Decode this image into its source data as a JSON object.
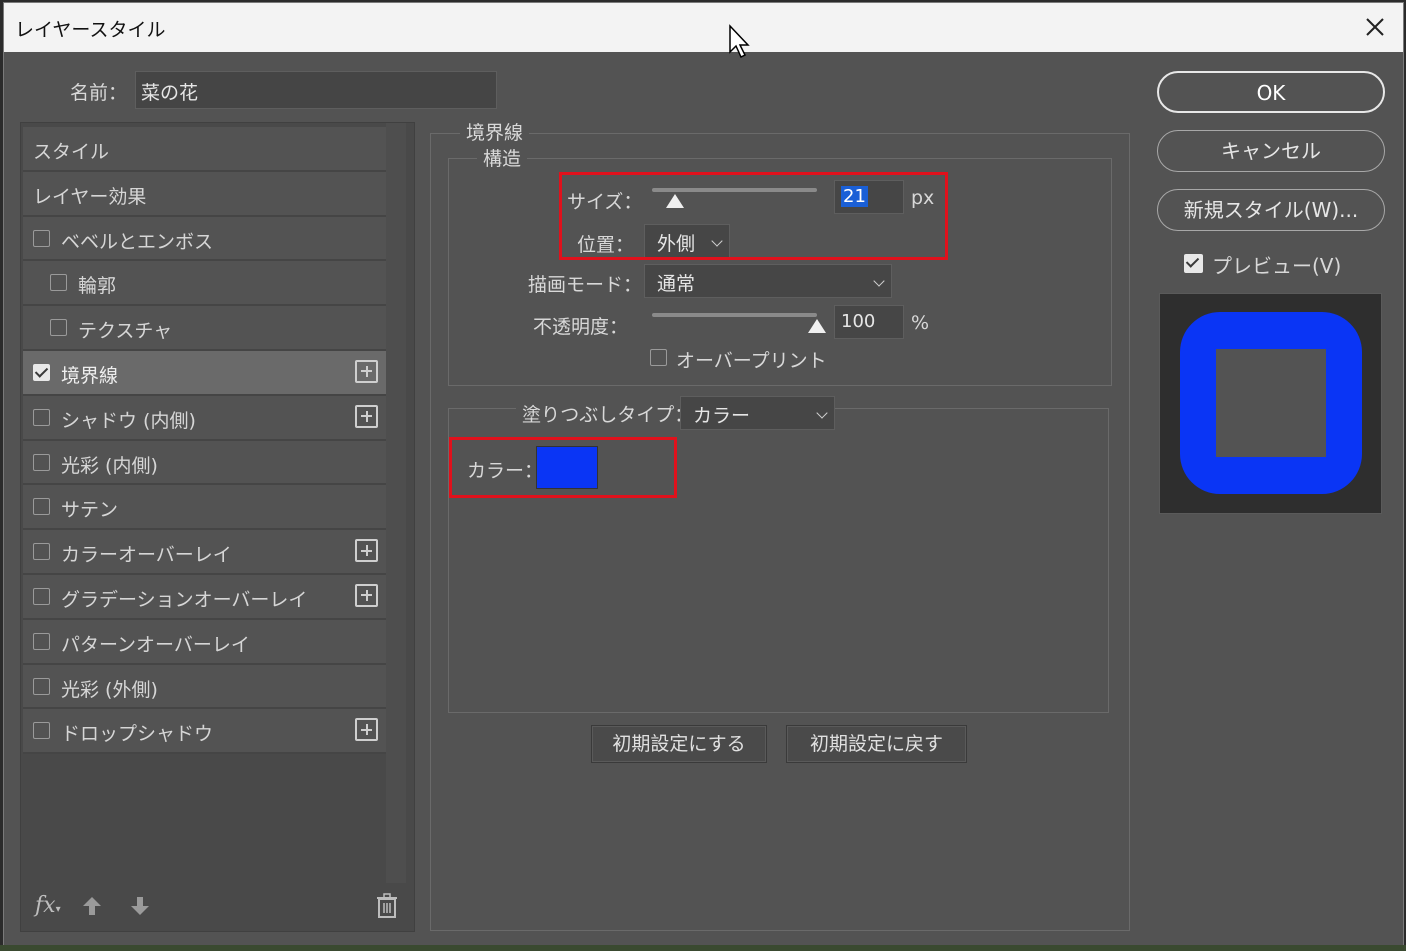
{
  "window": {
    "title": "レイヤースタイル"
  },
  "name_field": {
    "label": "名前：",
    "value": "菜の花"
  },
  "styles_list": [
    {
      "label": "スタイル",
      "checkbox": false,
      "checked": false,
      "indent": 0,
      "plus": false,
      "selected": false
    },
    {
      "label": "レイヤー効果",
      "checkbox": false,
      "checked": false,
      "indent": 0,
      "plus": false,
      "selected": false
    },
    {
      "label": "ベベルとエンボス",
      "checkbox": true,
      "checked": false,
      "indent": 0,
      "plus": false,
      "selected": false
    },
    {
      "label": "輪郭",
      "checkbox": true,
      "checked": false,
      "indent": 1,
      "plus": false,
      "selected": false
    },
    {
      "label": "テクスチャ",
      "checkbox": true,
      "checked": false,
      "indent": 1,
      "plus": false,
      "selected": false
    },
    {
      "label": "境界線",
      "checkbox": true,
      "checked": true,
      "indent": 0,
      "plus": true,
      "selected": true
    },
    {
      "label": "シャドウ (内側)",
      "checkbox": true,
      "checked": false,
      "indent": 0,
      "plus": true,
      "selected": false
    },
    {
      "label": "光彩 (内側)",
      "checkbox": true,
      "checked": false,
      "indent": 0,
      "plus": false,
      "selected": false
    },
    {
      "label": "サテン",
      "checkbox": true,
      "checked": false,
      "indent": 0,
      "plus": false,
      "selected": false
    },
    {
      "label": "カラーオーバーレイ",
      "checkbox": true,
      "checked": false,
      "indent": 0,
      "plus": true,
      "selected": false
    },
    {
      "label": "グラデーションオーバーレイ",
      "checkbox": true,
      "checked": false,
      "indent": 0,
      "plus": true,
      "selected": false
    },
    {
      "label": "パターンオーバーレイ",
      "checkbox": true,
      "checked": false,
      "indent": 0,
      "plus": false,
      "selected": false
    },
    {
      "label": "光彩 (外側)",
      "checkbox": true,
      "checked": false,
      "indent": 0,
      "plus": false,
      "selected": false
    },
    {
      "label": "ドロップシャドウ",
      "checkbox": true,
      "checked": false,
      "indent": 0,
      "plus": true,
      "selected": false
    }
  ],
  "list_footer": {
    "fx_label": "fx",
    "icons": [
      "fx-icon",
      "arrow-up-icon",
      "arrow-down-icon",
      "trash-icon"
    ]
  },
  "stroke": {
    "group_title": "境界線",
    "structure_title": "構造",
    "size_label": "サイズ：",
    "size_value": "21",
    "size_unit": "px",
    "size_slider_fraction": 0.14,
    "position_label": "位置：",
    "position_value": "外側",
    "blend_label": "描画モード：",
    "blend_value": "通常",
    "opacity_label": "不透明度：",
    "opacity_value": "100",
    "opacity_unit": "%",
    "opacity_slider_fraction": 1.0,
    "overprint_label": "オーバープリント",
    "overprint_checked": false,
    "fill_type_label": "塗りつぶしタイプ：",
    "fill_type_value": "カラー",
    "color_label": "カラー：",
    "color_value": "#0a35f5"
  },
  "buttons": {
    "make_default": "初期設定にする",
    "reset_default": "初期設定に戻す",
    "ok": "OK",
    "cancel": "キャンセル",
    "new_style": "新規スタイル(W)..."
  },
  "preview": {
    "label": "プレビュー(V)",
    "checked": true,
    "stroke_color": "#0a35f5"
  },
  "colors": {
    "highlight": "#e0111c",
    "selection": "#1a5fd6",
    "panel_bg": "#535353"
  }
}
